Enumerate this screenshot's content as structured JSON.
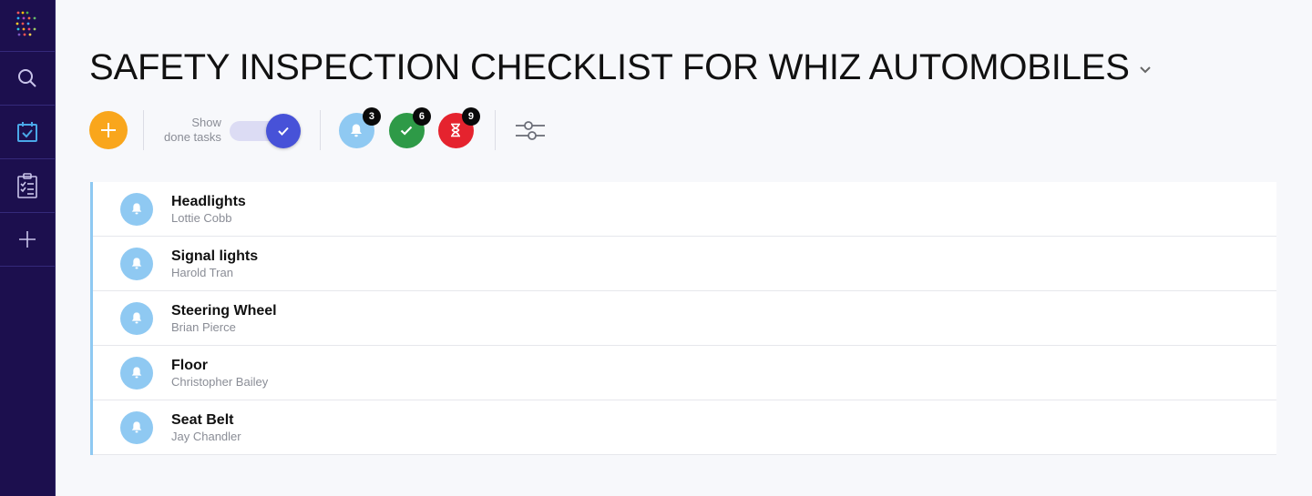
{
  "sidebar": {
    "items": [
      {
        "icon": "search-icon"
      },
      {
        "icon": "calendar-check-icon"
      },
      {
        "icon": "clipboard-list-icon"
      },
      {
        "icon": "plus-icon"
      }
    ]
  },
  "header": {
    "title": "SAFETY INSPECTION CHECKLIST FOR WHIZ AUTOMOBILES"
  },
  "toolbar": {
    "toggle_label_line1": "Show",
    "toggle_label_line2": "done tasks",
    "toggle_on": true,
    "status_counts": {
      "pending": "3",
      "done": "6",
      "overdue": "9"
    },
    "colors": {
      "add": "#f9a61c",
      "pending": "#8fc9f2",
      "done": "#2e9a47",
      "overdue": "#e5232e",
      "toggle": "#4752d8"
    }
  },
  "tasks": [
    {
      "title": "Headlights",
      "assignee": "Lottie Cobb"
    },
    {
      "title": "Signal lights",
      "assignee": "Harold Tran"
    },
    {
      "title": "Steering Wheel",
      "assignee": "Brian Pierce"
    },
    {
      "title": "Floor",
      "assignee": "Christopher Bailey"
    },
    {
      "title": "Seat Belt",
      "assignee": "Jay Chandler"
    }
  ]
}
